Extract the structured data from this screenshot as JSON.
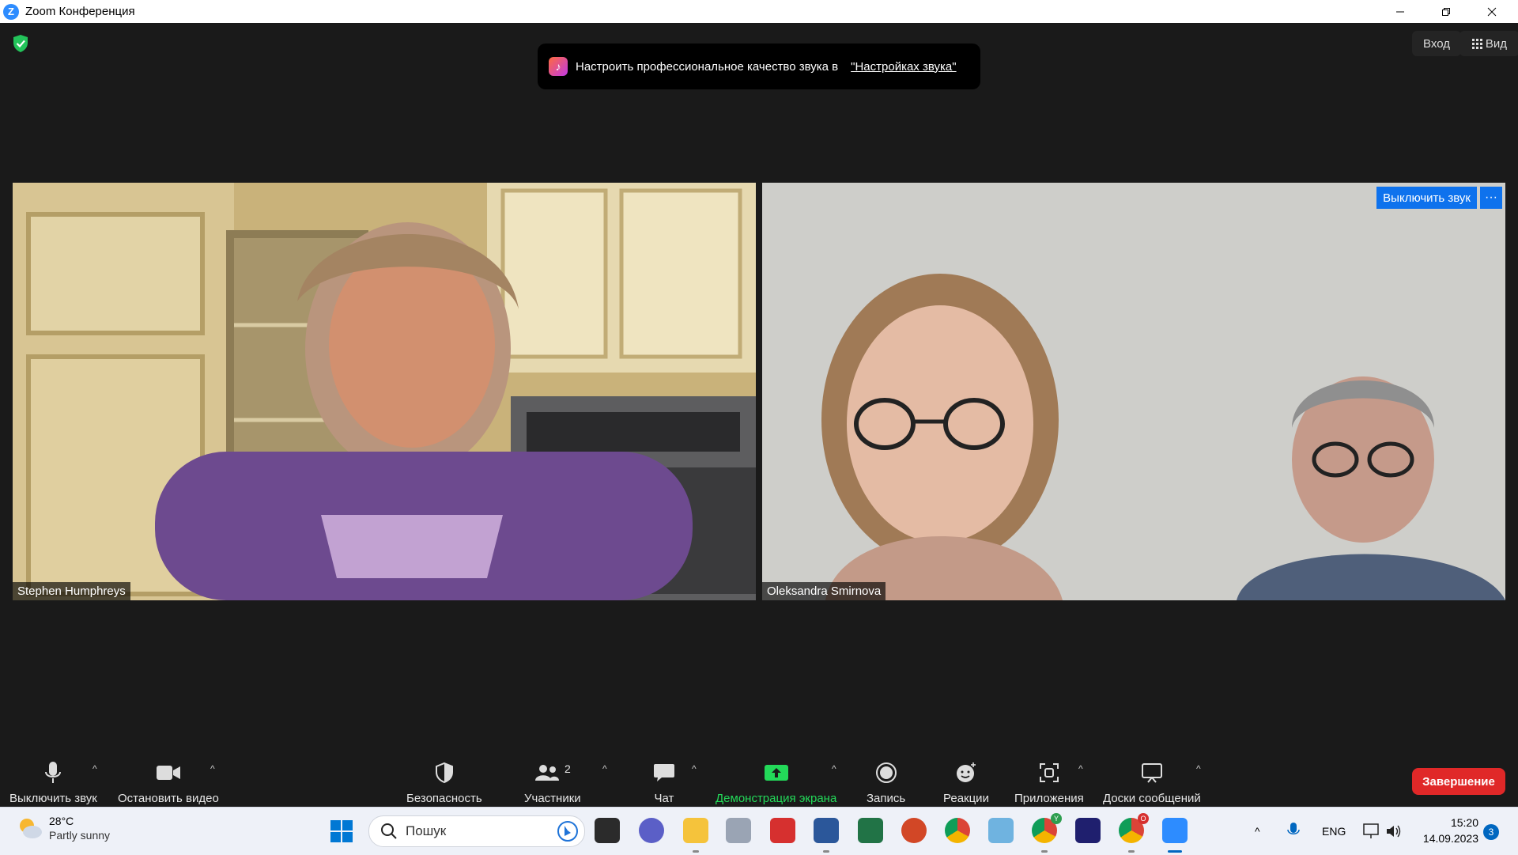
{
  "window": {
    "title": "Zoom Конференция"
  },
  "header": {
    "login_label": "Вход",
    "view_label": "Вид",
    "notice_text": "Настроить профессиональное качество звука в",
    "notice_link": "\"Настройках звука\""
  },
  "participants": [
    {
      "name": "Stephen Humphreys"
    },
    {
      "name": "Oleksandra Smirnova",
      "unmute_label": "Выключить звук"
    }
  ],
  "toolbar": {
    "mute_label": "Выключить звук",
    "video_label": "Остановить видео",
    "security_label": "Безопасность",
    "participants_label": "Участники",
    "participants_count": "2",
    "chat_label": "Чат",
    "share_label": "Демонстрация экрана",
    "record_label": "Запись",
    "reactions_label": "Реакции",
    "apps_label": "Приложения",
    "whiteboard_label": "Доски сообщений",
    "end_label": "Завершение"
  },
  "taskbar": {
    "weather_temp": "28°C",
    "weather_desc": "Partly sunny",
    "search_placeholder": "Пошук",
    "language": "ENG",
    "time": "15:20",
    "date": "14.09.2023",
    "notifications_count": "3",
    "badge_y": "Y",
    "badge_o": "O"
  },
  "colors": {
    "zoom_blue": "#0e72ed",
    "end_red": "#e02828",
    "share_green": "#23d959",
    "background": "#1a1a1a"
  }
}
